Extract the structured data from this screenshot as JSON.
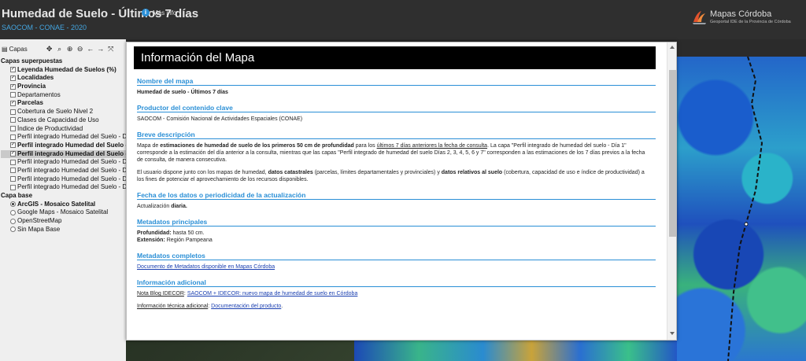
{
  "header": {
    "title": "Humedad de Suelo - Últimos 7 días",
    "more_info": "Más info",
    "subtitle": "SAOCOM - CONAE - 2020",
    "logo_name": "Mapas Córdoba",
    "logo_tagline": "Geoportal IDE de la Provincia de Córdoba"
  },
  "sidebar": {
    "layers_button": "Capas",
    "groups": [
      {
        "label": "Capas superpuestas",
        "items": [
          {
            "label": "Leyenda Humedad de Suelos (%)",
            "checked": true,
            "bold": true
          },
          {
            "label": "Localidades",
            "checked": true,
            "bold": true
          },
          {
            "label": "Provincia",
            "checked": true,
            "bold": true
          },
          {
            "label": "Departamentos",
            "checked": false,
            "bold": false
          },
          {
            "label": "Parcelas",
            "checked": true,
            "bold": true
          },
          {
            "label": "Cobertura de Suelo Nivel 2",
            "checked": false,
            "bold": false
          },
          {
            "label": "Clases de Capacidad de Uso",
            "checked": false,
            "bold": false
          },
          {
            "label": "Índice de Productividad",
            "checked": false,
            "bold": false
          },
          {
            "label": "Perfil integrado Humedad del Suelo - D",
            "checked": false,
            "bold": false
          },
          {
            "label": "Perfil integrado Humedad del Suelo - D",
            "checked": true,
            "bold": true
          },
          {
            "label": "Perfil integrado Humedad del Suelo - D",
            "checked": true,
            "bold": true,
            "selected": true
          },
          {
            "label": "Perfil integrado Humedad del Suelo - D",
            "checked": false,
            "bold": false
          },
          {
            "label": "Perfil integrado Humedad del Suelo - D",
            "checked": false,
            "bold": false
          },
          {
            "label": "Perfil integrado Humedad del Suelo - D",
            "checked": false,
            "bold": false
          },
          {
            "label": "Perfil integrado Humedad del Suelo - D",
            "checked": false,
            "bold": false
          }
        ]
      },
      {
        "label": "Capa base",
        "items": [
          {
            "label": "ArcGIS - Mosaico Satelital",
            "radio": true,
            "checked": true,
            "bold": true
          },
          {
            "label": "Google Maps - Mosaico Satelital",
            "radio": true,
            "checked": false,
            "bold": false
          },
          {
            "label": "OpenStreetMap",
            "radio": true,
            "checked": false,
            "bold": false
          },
          {
            "label": "Sin Mapa Base",
            "radio": true,
            "checked": false,
            "bold": false
          }
        ]
      }
    ]
  },
  "modal": {
    "title": "Información del Mapa",
    "sections": {
      "name_h": "Nombre del mapa",
      "name_v": "Humedad de suelo - Últimos 7 días",
      "producer_h": "Productor del contenido clave",
      "producer_v": "SAOCOM - Comisión Nacional de Actividades Espaciales (CONAE)",
      "desc_h": "Breve descripción",
      "desc_p1_a": "Mapa de ",
      "desc_p1_b": "estimaciones de humedad de suelo de los primeros 50 cm de profundidad",
      "desc_p1_c": " para los ",
      "desc_p1_d": "últimos 7 días anteriores la fecha de consulta",
      "desc_p1_e": ". La capa \"Perfil integrado de humedad del suelo - Día 1\" corresponde a la estimación del día anterior a la consulta, mientras que las capas \"Perfil integrado de humedad del suelo Días 2, 3, 4, 5, 6 y 7\" corresponden a las estimaciones de los 7 días previos a la fecha de consulta, de manera consecutiva.",
      "desc_p2_a": "El usuario dispone junto con los mapas de humedad, ",
      "desc_p2_b": "datos catastrales",
      "desc_p2_c": " (parcelas, límites departamentales y provinciales) y ",
      "desc_p2_d": "datos relativos al suelo",
      "desc_p2_e": " (cobertura, capacidad de uso e índice de productividad) a los fines de potenciar el aprovechamiento de los recursos disponibles.",
      "date_h": "Fecha de los datos o periodicidad de la actualización",
      "date_v_a": "Actualización ",
      "date_v_b": "diaria.",
      "meta_h": "Metadatos principales",
      "meta_depth_k": "Profundidad:",
      "meta_depth_v": " hasta 50 cm.",
      "meta_ext_k": "Extensión:",
      "meta_ext_v": " Región Pampeana",
      "full_h": "Metadatos completos",
      "full_link": "Documento de Metadatos disponible en Mapas Córdoba",
      "add_h": "Información adicional",
      "add_blog_k": "Nota Blog IDECOR",
      "add_blog_sep": ": ",
      "add_blog_link": "SAOCOM + IDECOR: nuevo mapa de humedad de suelo en Córdoba",
      "add_tech_k": "Información técnica adicional",
      "add_tech_sep": ": ",
      "add_tech_link": "Documentación del producto",
      "add_tech_end": "."
    }
  }
}
